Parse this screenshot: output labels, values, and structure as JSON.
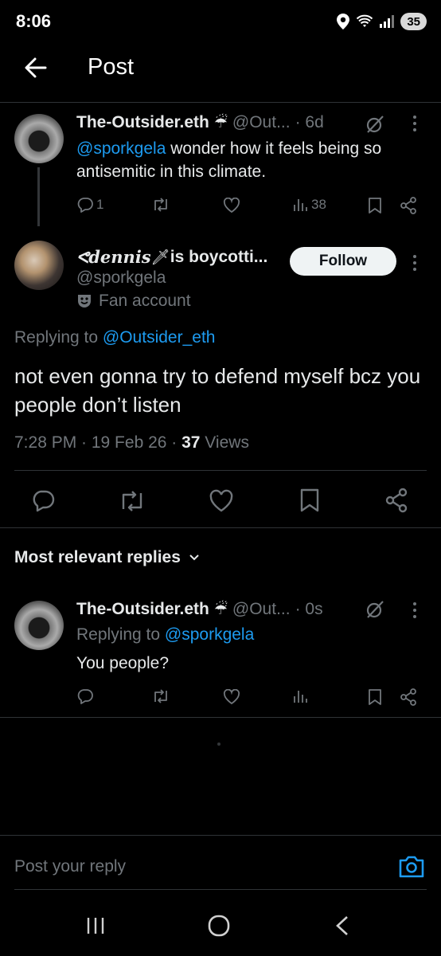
{
  "status_bar": {
    "time": "8:06",
    "battery": "35"
  },
  "header": {
    "title": "Post"
  },
  "parent_post": {
    "name": "The-Outsider.eth",
    "name_emoji": "☔",
    "handle": "@Out...",
    "time": "· 6d",
    "mention": "@sporkgela",
    "text": " wonder how it feels being so antisemitic in this climate.",
    "stats": {
      "replies": "1",
      "reposts": "",
      "likes": "",
      "views": "38"
    }
  },
  "main_post": {
    "name_prefix": "ᕙdennis",
    "name_emoji": "🗡",
    "name_suffix": " is boycotti...",
    "handle": "@sporkgela",
    "label": "Fan account",
    "follow_label": "Follow",
    "replying_prefix": "Replying to ",
    "replying_handle": "@Outsider_eth",
    "text": "not even gonna try to defend myself bcz you people don’t listen",
    "time": "7:28 PM · 19 Feb 26 · ",
    "views_count": "37",
    "views_label": " Views"
  },
  "replies_section": {
    "title": "Most relevant replies"
  },
  "reply": {
    "name": "The-Outsider.eth",
    "name_emoji": "☔",
    "handle": "@Out...",
    "time": "· 0s",
    "replying_prefix": "Replying to ",
    "replying_handle": "@sporkgela",
    "text": "You people?"
  },
  "compose": {
    "placeholder": "Post your reply"
  },
  "colors": {
    "accent": "#1d9bf0",
    "background": "#000000",
    "muted": "#71767b",
    "divider": "#2f3336"
  },
  "icons": [
    "back-arrow-icon",
    "reply-icon",
    "repost-icon",
    "like-icon",
    "views-icon",
    "bookmark-icon",
    "share-icon",
    "grok-icon",
    "more-icon",
    "camera-icon",
    "theater-mask-icon"
  ]
}
